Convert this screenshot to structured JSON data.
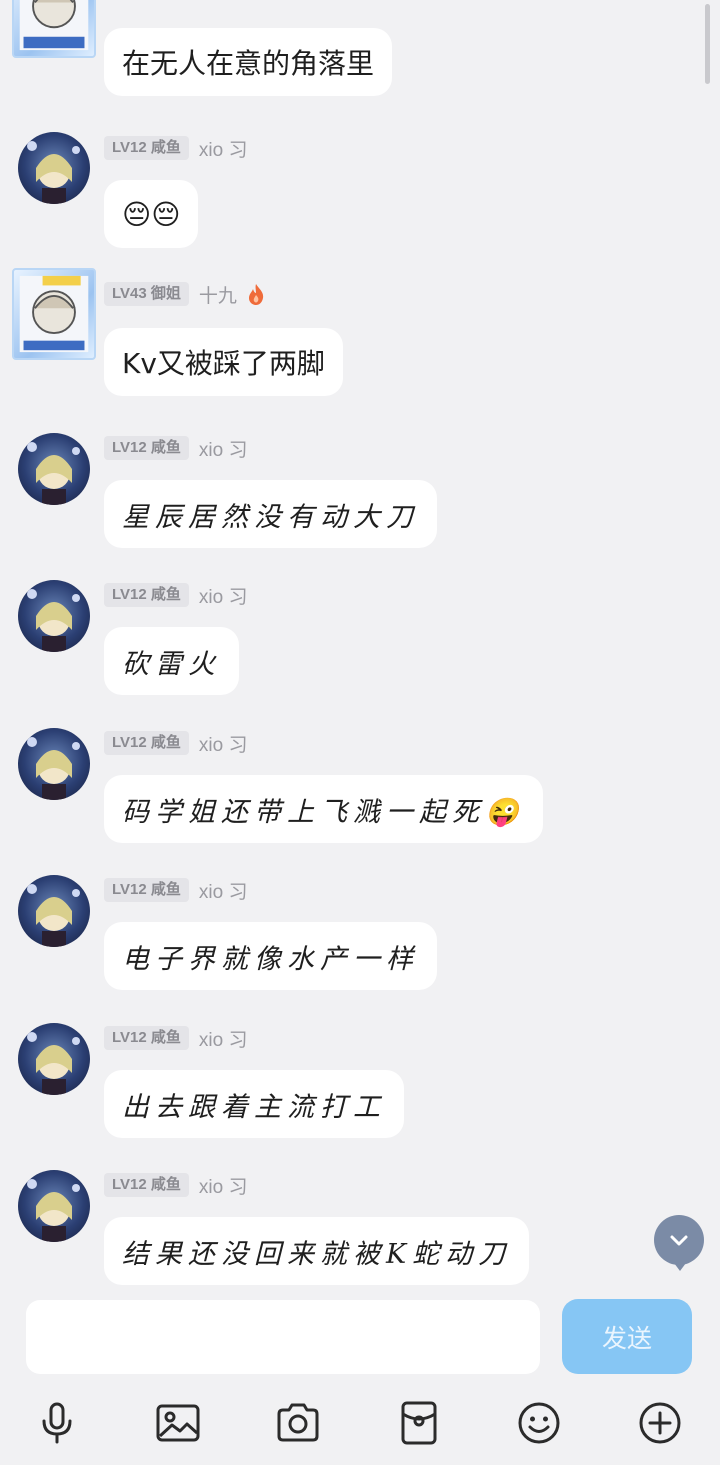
{
  "messages": [
    {
      "id": 0,
      "level": "",
      "nick": "",
      "text": "在无人在意的角落里",
      "style": "normal",
      "avatar": "frame"
    },
    {
      "id": 1,
      "level": "LV12 咸鱼",
      "nick": "xio 习",
      "text": "😔😔",
      "style": "normal",
      "avatar": "round"
    },
    {
      "id": 2,
      "level": "LV43 御姐",
      "nick": "十九",
      "text": "Kv又被踩了两脚",
      "style": "normal",
      "avatar": "frame",
      "flame": true
    },
    {
      "id": 3,
      "level": "LV12 咸鱼",
      "nick": "xio 习",
      "text": "星辰居然没有动大刀",
      "style": "hand",
      "avatar": "round"
    },
    {
      "id": 4,
      "level": "LV12 咸鱼",
      "nick": "xio 习",
      "text": "砍雷火",
      "style": "hand",
      "avatar": "round"
    },
    {
      "id": 5,
      "level": "LV12 咸鱼",
      "nick": "xio 习",
      "text": "码学姐还带上飞溅一起死😜",
      "style": "hand",
      "avatar": "round"
    },
    {
      "id": 6,
      "level": "LV12 咸鱼",
      "nick": "xio 习",
      "text": "电子界就像水产一样",
      "style": "hand",
      "avatar": "round"
    },
    {
      "id": 7,
      "level": "LV12 咸鱼",
      "nick": "xio 习",
      "text": "出去跟着主流打工",
      "style": "hand",
      "avatar": "round"
    },
    {
      "id": 8,
      "level": "LV12 咸鱼",
      "nick": "xio 习",
      "text": "结果还没回来就被K蛇动刀",
      "style": "hand",
      "avatar": "round"
    }
  ],
  "composer": {
    "placeholder": "",
    "send_label": "发送"
  },
  "toolbar": [
    "microphone-icon",
    "image-icon",
    "camera-icon",
    "red-packet-icon",
    "emoji-icon",
    "plus-icon"
  ],
  "colors": {
    "background": "#f1f1f3",
    "bubble": "#ffffff",
    "send_button": "#86c6f4",
    "scroll_down_button": "#7b8ba6"
  }
}
